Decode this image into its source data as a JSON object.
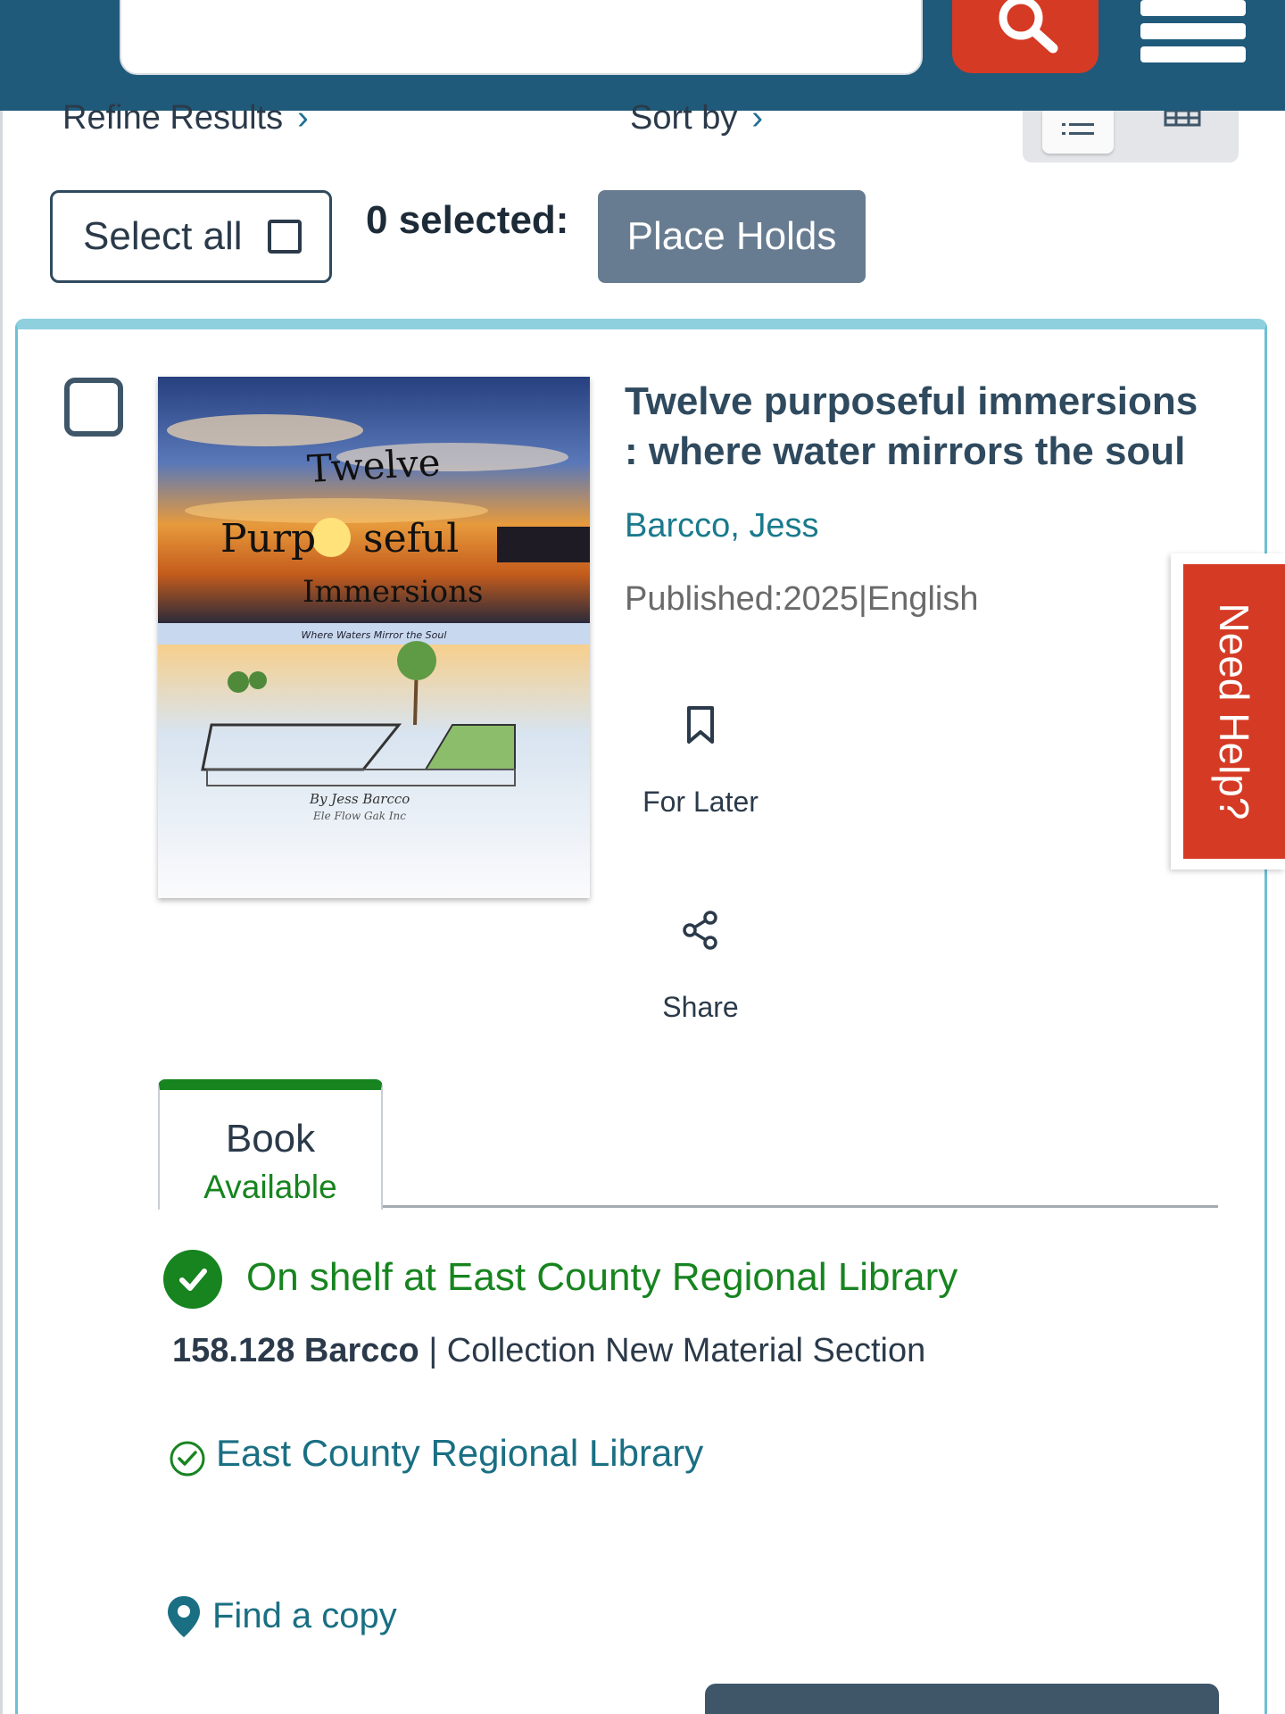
{
  "header": {
    "search_placeholder": "",
    "search_icon": "search-icon",
    "menu_icon": "hamburger-menu-icon"
  },
  "toolbar": {
    "refine_label": "Refine Results",
    "sort_label": "Sort by",
    "view_list_icon": "list-view-icon",
    "view_grid_icon": "grid-view-icon"
  },
  "selection": {
    "select_all_label": "Select all",
    "selected_count": "0 selected:",
    "place_holds_label": "Place Holds"
  },
  "result": {
    "title": "Twelve purposeful immersions : where water mirrors the soul",
    "author": "Barcco, Jess",
    "published": "Published:2025|English",
    "cover": {
      "title_line1": "Twelve",
      "title_line2": "Purp",
      "title_line2b": "seful",
      "title_line3": "Immersions",
      "subtitle": "Where Waters Mirror the Soul",
      "byline": "By Jess Barcco",
      "publisher": "Ele Flow Gak Inc"
    },
    "actions": {
      "for_later": "For Later",
      "share": "Share"
    },
    "format": {
      "name": "Book",
      "status": "Available"
    },
    "availability": {
      "on_shelf": "On shelf at East County Regional Library",
      "call_number": "158.128 Barcco",
      "separator": "|",
      "collection": "Collection New Material Section",
      "branch": "East County Regional Library",
      "find_copy": "Find a copy"
    }
  },
  "help": {
    "label": "Need Help?"
  },
  "colors": {
    "header_bg": "#1f5a7a",
    "search_button": "#d53a24",
    "place_holds_bg": "#677c90",
    "card_border": "#6ec0d3",
    "available_green": "#17841f",
    "link_teal": "#1a6f83"
  }
}
